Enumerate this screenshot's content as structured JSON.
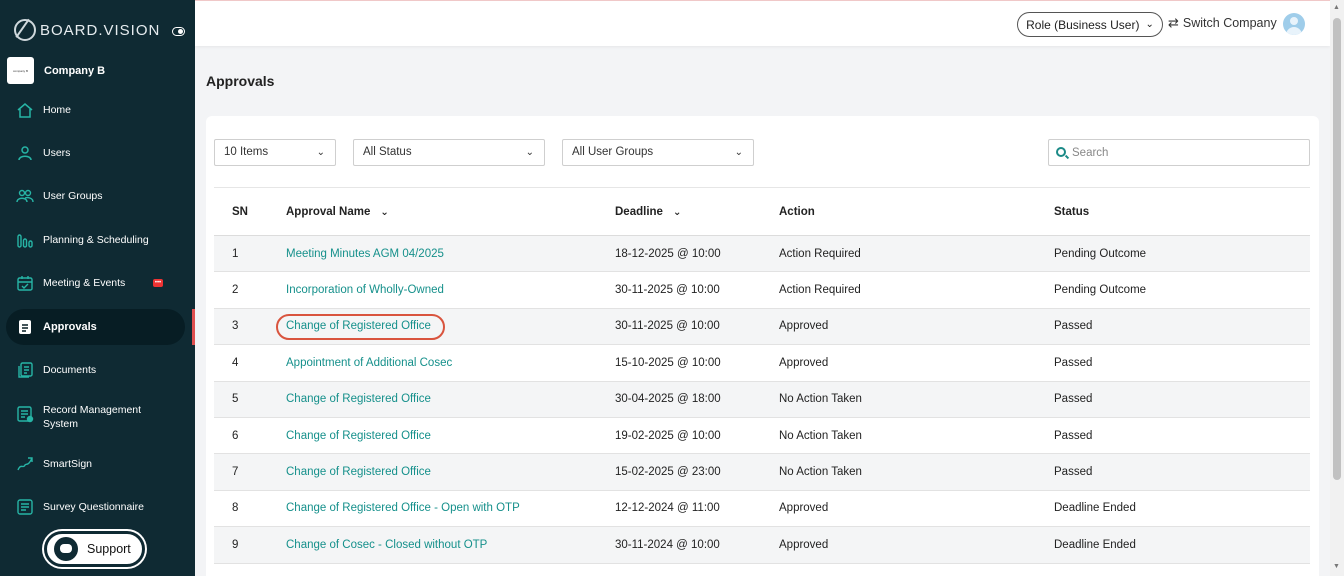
{
  "brand": {
    "name": "BOARD.VISION"
  },
  "company": {
    "name": "Company B",
    "logo_text": "company B"
  },
  "sidebar": {
    "items": [
      {
        "label": "Home",
        "icon": "home-icon"
      },
      {
        "label": "Users",
        "icon": "user-icon"
      },
      {
        "label": "User Groups",
        "icon": "user-group-icon"
      },
      {
        "label": "Planning & Scheduling",
        "icon": "bar-chart-icon"
      },
      {
        "label": "Meeting & Events",
        "icon": "calendar-icon",
        "badge": "•••"
      },
      {
        "label": "Approvals",
        "icon": "approvals-icon",
        "active": true
      },
      {
        "label": "Documents",
        "icon": "documents-icon"
      },
      {
        "label": "Record Management",
        "label2": "System",
        "icon": "record-icon"
      },
      {
        "label": "SmartSign",
        "icon": "signature-icon"
      },
      {
        "label": "Survey Questionnaire",
        "icon": "survey-icon"
      }
    ],
    "support_label": "Support"
  },
  "topbar": {
    "role_label": "Role (Business User)",
    "switch_label": "Switch Company"
  },
  "page": {
    "title": "Approvals"
  },
  "filters": {
    "items_per_page": "10 Items",
    "status": "All Status",
    "user_groups": "All User Groups",
    "search_placeholder": "Search"
  },
  "table": {
    "headers": {
      "sn": "SN",
      "name": "Approval Name",
      "deadline": "Deadline",
      "action": "Action",
      "status": "Status"
    },
    "rows": [
      {
        "sn": "1",
        "name": "Meeting Minutes AGM 04/2025",
        "deadline": "18-12-2025 @ 10:00",
        "action": "Action Required",
        "status": "Pending Outcome"
      },
      {
        "sn": "2",
        "name": "Incorporation of Wholly-Owned",
        "deadline": "30-11-2025 @ 10:00",
        "action": "Action Required",
        "status": "Pending Outcome"
      },
      {
        "sn": "3",
        "name": "Change of Registered Office",
        "deadline": "30-11-2025 @ 10:00",
        "action": "Approved",
        "status": "Passed"
      },
      {
        "sn": "4",
        "name": "Appointment of Additional Cosec",
        "deadline": "15-10-2025 @ 10:00",
        "action": "Approved",
        "status": "Passed"
      },
      {
        "sn": "5",
        "name": "Change of Registered Office",
        "deadline": "30-04-2025 @ 18:00",
        "action": "No Action Taken",
        "status": "Passed"
      },
      {
        "sn": "6",
        "name": "Change of Registered Office",
        "deadline": "19-02-2025 @ 10:00",
        "action": "No Action Taken",
        "status": "Passed"
      },
      {
        "sn": "7",
        "name": "Change of Registered Office",
        "deadline": "15-02-2025 @ 23:00",
        "action": "No Action Taken",
        "status": "Passed"
      },
      {
        "sn": "8",
        "name": "Change of Registered Office - Open with OTP",
        "deadline": "12-12-2024 @ 11:00",
        "action": "Approved",
        "status": "Deadline Ended"
      },
      {
        "sn": "9",
        "name": "Change of Cosec - Closed without OTP",
        "deadline": "30-11-2024 @ 10:00",
        "action": "Approved",
        "status": "Deadline Ended"
      }
    ]
  },
  "colors": {
    "sidebar_bg": "#0f2a33",
    "accent": "#15908b",
    "highlight": "#d9543e"
  }
}
